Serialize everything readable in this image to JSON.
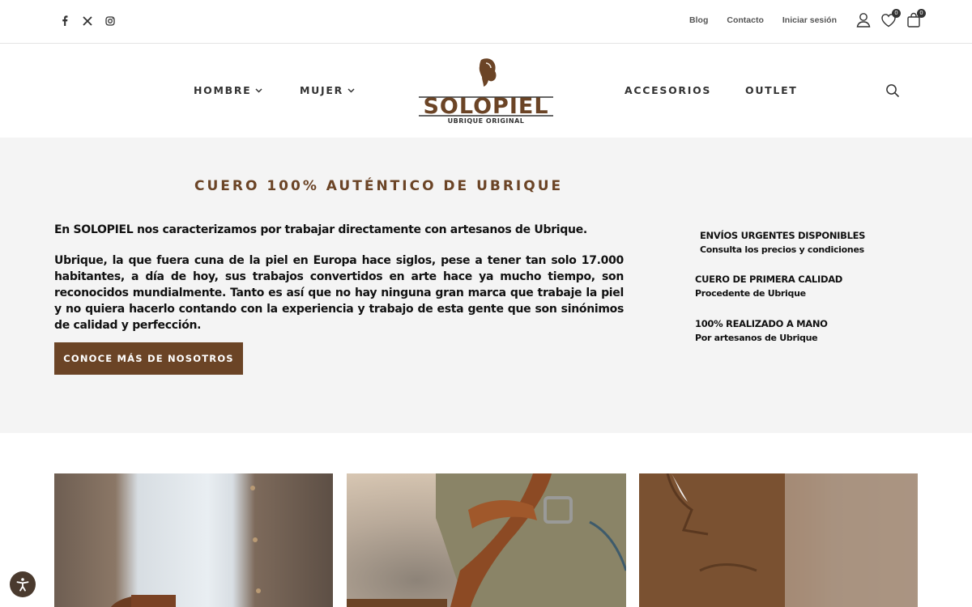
{
  "topbar": {
    "social": [
      {
        "icon": "facebook-icon"
      },
      {
        "icon": "x-icon"
      },
      {
        "icon": "instagram-icon"
      }
    ],
    "links": [
      "Blog",
      "Contacto",
      "Iniciar sesión"
    ],
    "wishlist_count": "0",
    "cart_count": "0"
  },
  "nav": {
    "hombre": "HOMBRE",
    "mujer": "MUJER",
    "accesorios": "ACCESORIOS",
    "outlet": "OUTLET",
    "logo_text": "SOLOPIEL",
    "logo_subtext": "UBRIQUE ORIGINAL"
  },
  "hero": {
    "title": "CUERO 100% AUTÉNTICO DE UBRIQUE",
    "intro": "En SOLOPIEL nos caracterizamos por trabajar directamente con artesanos de Ubrique.",
    "paragraph": "Ubrique, la que fuera cuna de la piel en Europa hace siglos, pese a tener tan solo 17.000 habitantes, a día de hoy,  sus trabajos convertidos en arte hace ya mucho tiempo,  son reconocidos mundialmente. Tanto es así que no hay ninguna gran marca que trabaje la piel y no quiera hacerlo contando con la experiencia y trabajo de esta gente que son sinónimos de calidad y perfección.",
    "cta": "CONOCE MÁS DE NOSOTROS"
  },
  "features": [
    {
      "title": "ENVÍOS URGENTES DISPONIBLES",
      "subtitle": "Consulta los precios y condiciones"
    },
    {
      "title": "CUERO DE PRIMERA CALIDAD",
      "subtitle": "Procedente de Ubrique"
    },
    {
      "title": "100% REALIZADO A MANO",
      "subtitle": "Por artesanos de Ubrique"
    }
  ],
  "colors": {
    "brand_brown": "#6b4426",
    "hero_bg": "#f4f4f4"
  }
}
